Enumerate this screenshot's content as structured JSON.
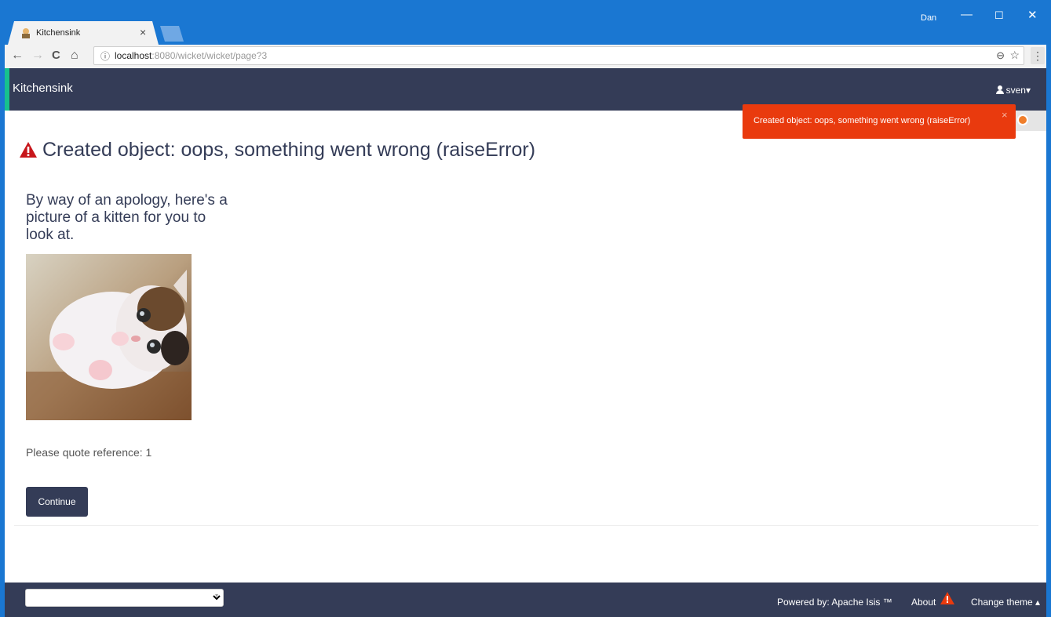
{
  "browser": {
    "tab_title": "Kitchensink",
    "tab_close": "×",
    "window_user": "Dan",
    "url_host": "localhost",
    "url_rest": ":8080/wicket/wicket/page?3",
    "info_icon": "ⓘ",
    "zoom_icon": "⊖",
    "star_icon": "☆",
    "menu_icon": "⋮",
    "back_icon": "←",
    "forward_icon": "→",
    "reload_icon": "C",
    "home_icon": "⌂",
    "minimize": "—",
    "maximize": "☐",
    "close": "✕"
  },
  "navbar": {
    "brand": "Kitchensink",
    "user": "sven",
    "user_caret": "▾"
  },
  "toast": {
    "message": "Created object: oops, something went wrong (raiseError)",
    "close": "×"
  },
  "error": {
    "heading": "Created object: oops, something went wrong (raiseError)",
    "apology": "By way of an apology, here's a picture of a kitten for you to look at.",
    "reference": "Please quote reference: 1",
    "continue_label": "Continue"
  },
  "footer": {
    "select_caret": "▾",
    "powered": "Powered by:  Apache Isis ™",
    "about": "About",
    "change_theme": "Change theme ▴"
  },
  "colors": {
    "navbar": "#343c57",
    "accent": "#17c18e",
    "toast": "#e93a0e",
    "warning": "#c7161b"
  }
}
